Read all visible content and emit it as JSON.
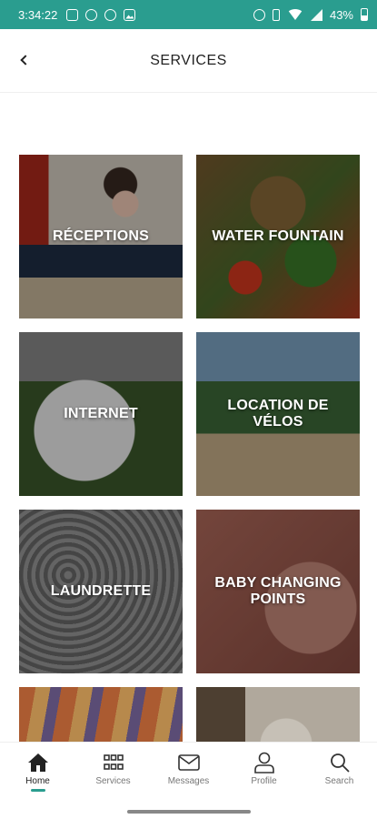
{
  "status_bar": {
    "time": "3:34:22",
    "battery_percent": "43%",
    "icons_left": [
      "instagram-icon",
      "record-icon",
      "at-icon",
      "image-icon"
    ],
    "icons_right": [
      "alarm-icon",
      "vibrate-icon",
      "wifi-icon",
      "signal-icon",
      "battery-icon"
    ],
    "background_color": "#2a9d8f"
  },
  "header": {
    "title": "SERVICES",
    "back_icon": "chevron-left-icon"
  },
  "services": [
    {
      "label": "RÉCEPTIONS"
    },
    {
      "label": "WATER FOUNTAIN"
    },
    {
      "label": "INTERNET"
    },
    {
      "label": "LOCATION DE VÉLOS"
    },
    {
      "label": "LAUNDRETTE"
    },
    {
      "label": "BABY CHANGING POINTS"
    },
    {
      "label": ""
    },
    {
      "label": ""
    }
  ],
  "bottom_nav": {
    "items": [
      {
        "label": "Home",
        "icon": "home-icon",
        "active": true
      },
      {
        "label": "Services",
        "icon": "grid-icon",
        "active": false
      },
      {
        "label": "Messages",
        "icon": "mail-icon",
        "active": false
      },
      {
        "label": "Profile",
        "icon": "user-icon",
        "active": false
      },
      {
        "label": "Search",
        "icon": "search-icon",
        "active": false
      }
    ],
    "accent_color": "#2a9d8f"
  }
}
